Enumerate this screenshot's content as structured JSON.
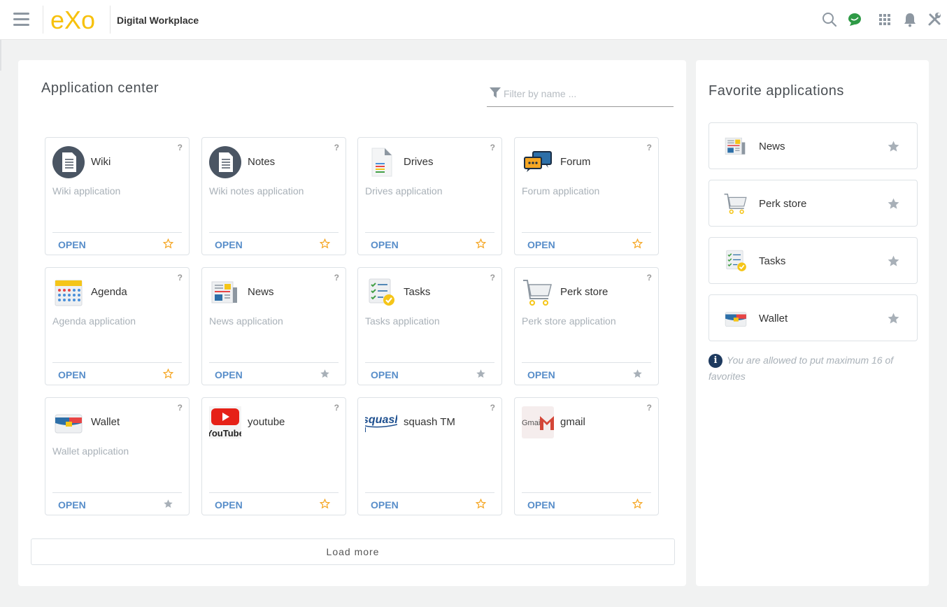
{
  "header": {
    "brand_name": "Digital Workplace",
    "logo_text": "eXo",
    "icons": [
      "search-icon",
      "chat-icon",
      "apps-grid-icon",
      "notifications-bell-icon",
      "admin-tools-icon"
    ]
  },
  "app_center": {
    "title": "Application center",
    "filter_placeholder": "Filter by name ...",
    "open_label": "OPEN",
    "help_label": "?",
    "load_more_label": "Load more",
    "apps": [
      {
        "name": "Wiki",
        "description": "Wiki application",
        "icon": "wiki-icon",
        "favorite": false
      },
      {
        "name": "Notes",
        "description": "Wiki notes application",
        "icon": "notes-icon",
        "favorite": false
      },
      {
        "name": "Drives",
        "description": "Drives application",
        "icon": "drives-icon",
        "favorite": false
      },
      {
        "name": "Forum",
        "description": "Forum application",
        "icon": "forum-icon",
        "favorite": false
      },
      {
        "name": "Agenda",
        "description": "Agenda application",
        "icon": "agenda-icon",
        "favorite": false
      },
      {
        "name": "News",
        "description": "News application",
        "icon": "news-icon",
        "favorite": true
      },
      {
        "name": "Tasks",
        "description": "Tasks application",
        "icon": "tasks-icon",
        "favorite": true
      },
      {
        "name": "Perk store",
        "description": "Perk store application",
        "icon": "perk-store-icon",
        "favorite": true
      },
      {
        "name": "Wallet",
        "description": "Wallet application",
        "icon": "wallet-icon",
        "favorite": true
      },
      {
        "name": "youtube",
        "description": "",
        "icon": "youtube-icon",
        "favorite": false
      },
      {
        "name": "squash TM",
        "description": "",
        "icon": "squash-icon",
        "favorite": false
      },
      {
        "name": "gmail",
        "description": "",
        "icon": "gmail-icon",
        "favorite": false
      }
    ],
    "youtube_logo_text": "YouTube",
    "squash_logo_text": "squash",
    "gmail_logo_text": "Gmail"
  },
  "favorites": {
    "title": "Favorite applications",
    "items": [
      {
        "name": "News",
        "icon": "news-icon"
      },
      {
        "name": "Perk store",
        "icon": "perk-store-icon"
      },
      {
        "name": "Tasks",
        "icon": "tasks-icon"
      },
      {
        "name": "Wallet",
        "icon": "wallet-icon"
      }
    ],
    "info_symbol": "i",
    "note": "You are allowed to put maximum 16 of favorites"
  },
  "colors": {
    "accent": "#578dc9",
    "star_unfavorite": "#f5a623",
    "star_favorite": "#a8b0b8",
    "logo_yellow": "#f7c10c"
  }
}
